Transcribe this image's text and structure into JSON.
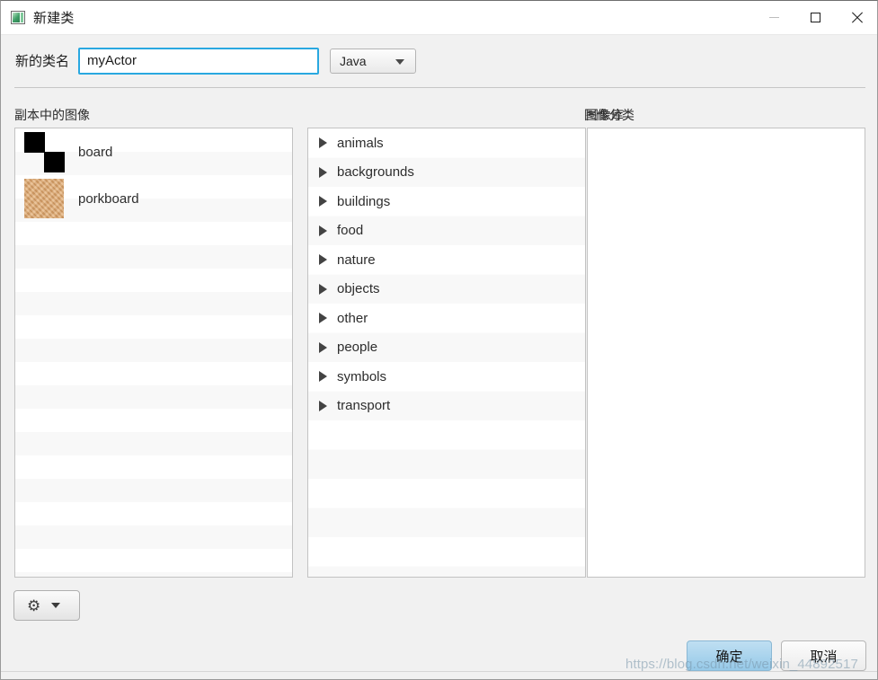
{
  "window": {
    "title": "新建类",
    "app_icon": "greenfoot-app-icon",
    "controls": {
      "minimize": "minimize-icon",
      "maximize": "maximize-icon",
      "close": "close-icon"
    }
  },
  "form": {
    "name_label": "新的类名",
    "name_value": "myActor",
    "name_placeholder": "",
    "language_value": "Java",
    "language_options": [
      "Java"
    ]
  },
  "headers": {
    "scripts": "副本中的图像",
    "categories": "图像分类",
    "library": "图像库"
  },
  "script_images": [
    {
      "name": "board",
      "thumb": "board-checker-thumbnail"
    },
    {
      "name": "porkboard",
      "thumb": "porkboard-cork-thumbnail"
    }
  ],
  "categories": [
    {
      "label": "animals"
    },
    {
      "label": "backgrounds"
    },
    {
      "label": "buildings"
    },
    {
      "label": "food"
    },
    {
      "label": "nature"
    },
    {
      "label": "objects"
    },
    {
      "label": "other"
    },
    {
      "label": "people"
    },
    {
      "label": "symbols"
    },
    {
      "label": "transport"
    }
  ],
  "library_images": [],
  "toolbar": {
    "gear_icon": "gear-icon",
    "gear_caret": "chevron-down-icon"
  },
  "buttons": {
    "ok": "确定",
    "cancel": "取消"
  },
  "watermark": "https://blog.csdn.net/weixin_44892517",
  "colors": {
    "accent": "#29a8e0",
    "default_button": "#96c9e8",
    "dialog_bg": "#f1f1f1",
    "panel_bg": "#ffffff",
    "stripe": "#f8f8f8",
    "cork": "#dfa971"
  }
}
